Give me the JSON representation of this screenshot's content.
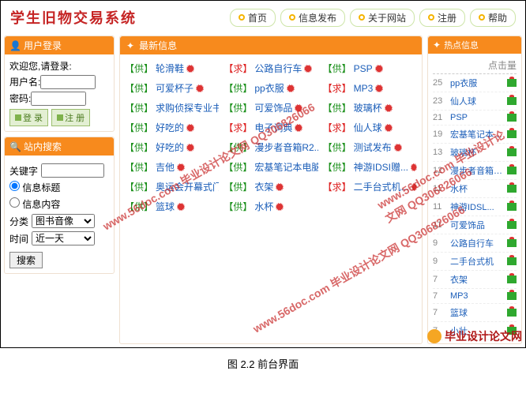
{
  "logo": "学生旧物交易系统",
  "nav": [
    "首页",
    "信息发布",
    "关于网站",
    "注册",
    "帮助"
  ],
  "login": {
    "title": "用户登录",
    "welcome": "欢迎您,请登录:",
    "user_lbl": "用户名:",
    "pass_lbl": "密码:",
    "login_btn": "登 录",
    "reg_btn": "注 册"
  },
  "search": {
    "title": "站内搜索",
    "kw_lbl": "关键字",
    "kw_val": "",
    "radio1": "信息标题",
    "radio2": "信息内容",
    "cat_lbl": "分类",
    "cat_val": "图书音像",
    "time_lbl": "时间",
    "time_val": "近一天",
    "btn": "搜索"
  },
  "latest": {
    "title": "最新信息",
    "items": [
      {
        "t": "供",
        "txt": "轮滑鞋"
      },
      {
        "t": "求",
        "txt": "公路自行车"
      },
      {
        "t": "供",
        "txt": "PSP"
      },
      {
        "t": "供",
        "txt": "可爱杯子"
      },
      {
        "t": "供",
        "txt": "pp衣服"
      },
      {
        "t": "求",
        "txt": "MP3"
      },
      {
        "t": "供",
        "txt": "求购侦探专业书"
      },
      {
        "t": "供",
        "txt": "可爱饰品"
      },
      {
        "t": "供",
        "txt": "玻璃杯"
      },
      {
        "t": "供",
        "txt": "好吃的"
      },
      {
        "t": "求",
        "txt": "电子词典"
      },
      {
        "t": "求",
        "txt": "仙人球"
      },
      {
        "t": "供",
        "txt": "好吃的"
      },
      {
        "t": "供",
        "txt": "漫步者音箱R2..."
      },
      {
        "t": "供",
        "txt": "测试发布"
      },
      {
        "t": "供",
        "txt": "吉他"
      },
      {
        "t": "供",
        "txt": "宏基笔记本电脑"
      },
      {
        "t": "供",
        "txt": "神游IDSI赠..."
      },
      {
        "t": "供",
        "txt": "奥运会开幕式门..."
      },
      {
        "t": "供",
        "txt": "衣架"
      },
      {
        "t": "求",
        "txt": "二手台式机..."
      },
      {
        "t": "供",
        "txt": "篮球"
      },
      {
        "t": "供",
        "txt": "水杯"
      }
    ]
  },
  "hot": {
    "title": "热点信息",
    "heading": "点击量",
    "items": [
      {
        "c": 25,
        "t": "pp衣服"
      },
      {
        "c": 23,
        "t": "仙人球"
      },
      {
        "c": 21,
        "t": "PSP"
      },
      {
        "c": 19,
        "t": "宏基笔记本电..."
      },
      {
        "c": 13,
        "t": "玻璃杯"
      },
      {
        "c": 12,
        "t": "漫步者音箱R..."
      },
      {
        "c": 11,
        "t": "水杯"
      },
      {
        "c": 11,
        "t": "神游IDSL..."
      },
      {
        "c": 11,
        "t": "可爱饰品"
      },
      {
        "c": 9,
        "t": "公路自行车"
      },
      {
        "c": 9,
        "t": "二手台式机"
      },
      {
        "c": 7,
        "t": "衣架"
      },
      {
        "c": 7,
        "t": "MP3"
      },
      {
        "c": 7,
        "t": "篮球"
      },
      {
        "c": 7,
        "t": "小壮"
      }
    ]
  },
  "caption": "图 2.2 前台界面",
  "footer": "毕业设计论文网",
  "watermark": "www.56doc.com 毕业设计论文网 QQ306826066"
}
